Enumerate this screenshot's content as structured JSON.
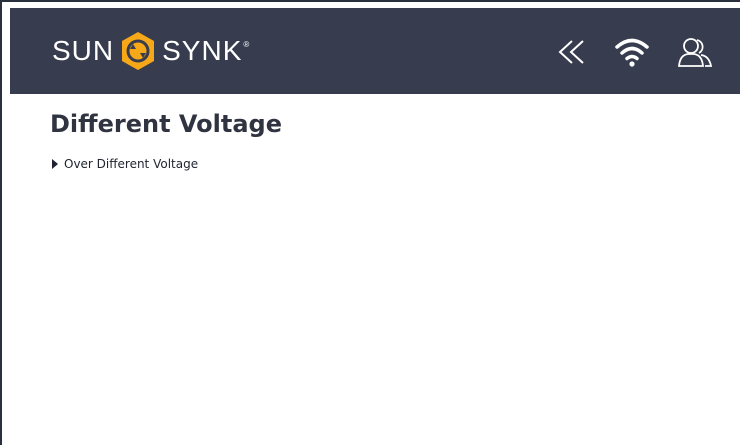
{
  "header": {
    "brand_left": "SUN",
    "brand_right": "SYNK",
    "brand_tm": "®",
    "brand_color": "#373d4e",
    "badge_color": "#f6a818",
    "icons": [
      "chevrons-left-icon",
      "wifi-icon",
      "users-icon"
    ]
  },
  "page": {
    "title": "Different Voltage",
    "items": [
      {
        "label": "Over Different Voltage"
      }
    ]
  }
}
